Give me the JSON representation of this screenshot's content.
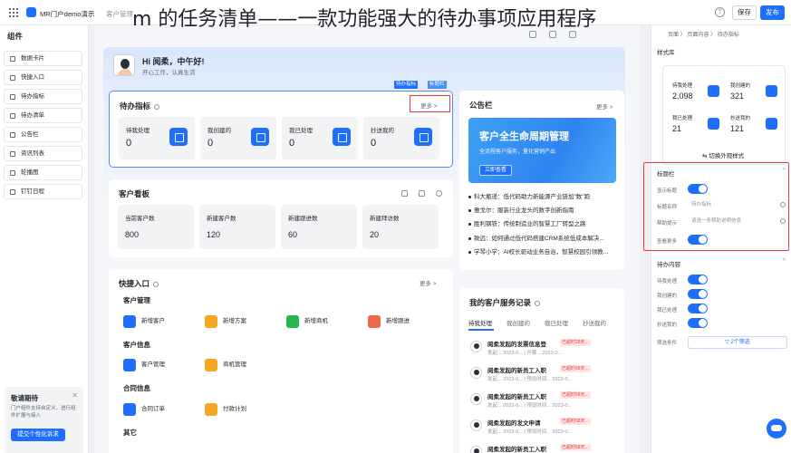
{
  "overlay_title": "m 的任务清单——一款功能强大的待办事项应用程序",
  "topbar": {
    "app_name": "MR门户demo演示",
    "page_name": "客户管理",
    "help": "?",
    "save": "保存",
    "publish": "发布"
  },
  "sidebar": {
    "title": "组件",
    "items": [
      {
        "label": "数据卡片"
      },
      {
        "label": "快捷入口"
      },
      {
        "label": "待办指标"
      },
      {
        "label": "待办清单"
      },
      {
        "label": "公告栏"
      },
      {
        "label": "资讯列表"
      },
      {
        "label": "轮播图"
      },
      {
        "label": "钉钉日程"
      }
    ],
    "promo": {
      "title": "敬请期待",
      "text": "门户组件支持自定义，进行组件扩展与接入",
      "button": "提交个性化诉求"
    }
  },
  "greeting": {
    "title": "Hi 阅柔，中午好!",
    "subtitle": "开心工作，认真生活"
  },
  "todo": {
    "title": "待办指标",
    "more": "更多 >",
    "stats": [
      {
        "label": "待我处理",
        "value": "0"
      },
      {
        "label": "我创建的",
        "value": "0"
      },
      {
        "label": "我已处理",
        "value": "0"
      },
      {
        "label": "抄送我的",
        "value": "0"
      }
    ]
  },
  "notice": {
    "title": "公告栏",
    "more": "更多 >",
    "banner": {
      "title": "客户全生命周期管理",
      "subtitle": "全流程客户服务，量化营销产出",
      "button": "立即查看"
    },
    "items": [
      "科大瓶递：低代码助力新能源产业链加\"数\"跑",
      "雅戈尔：服装行业龙头的数字创新指南",
      "胜利钢铁：传统制造业的智慧工厂转型之路",
      "致远：如何通过低代码搭建CRM系统低成本解决...",
      "学琴小学：AI校长驱动业务自治，智慧校园引领教..."
    ]
  },
  "board": {
    "title": "客户看板",
    "kpis": [
      {
        "label": "当前客户数",
        "value": "800"
      },
      {
        "label": "新建客户数",
        "value": "120"
      },
      {
        "label": "新建跟进数",
        "value": "60"
      },
      {
        "label": "新建拜访数",
        "value": "20"
      }
    ]
  },
  "quick": {
    "title": "快捷入口",
    "more": "更多 >",
    "groups": [
      {
        "title": "客户管理",
        "items": [
          {
            "label": "新增客户",
            "color": "#1e6fff"
          },
          {
            "label": "新增方案",
            "color": "#f5a623"
          },
          {
            "label": "新增商机",
            "color": "#2bb550"
          },
          {
            "label": "新增跟进",
            "color": "#f06a47"
          }
        ]
      },
      {
        "title": "客户信息",
        "items": [
          {
            "label": "客户管理",
            "color": "#1e6fff"
          },
          {
            "label": "商机管理",
            "color": "#f5a623"
          }
        ]
      },
      {
        "title": "合同信息",
        "items": [
          {
            "label": "合同订单",
            "color": "#1e6fff"
          },
          {
            "label": "付款计划",
            "color": "#f5a623"
          }
        ]
      },
      {
        "title": "其它",
        "items": []
      }
    ]
  },
  "service": {
    "title": "我的客户服务记录",
    "tabs": [
      "待我处理",
      "我创建的",
      "我已处理",
      "抄送我的"
    ],
    "records": [
      {
        "title": "阅柔发起的发票信息登",
        "tag": "已超时28天...",
        "sub": "发起... 2023-0...  | 开票... 2023-0..."
      },
      {
        "title": "阅柔发起的新员工入职",
        "tag": "已超时68天...",
        "sub": "发起... 2023-0...  | 预设时间... 2023-0..."
      },
      {
        "title": "阅柔发起的新员工入职",
        "tag": "已超时68天...",
        "sub": "发起... 2023-0...  | 预设时间... 2023-0..."
      },
      {
        "title": "阅柔发起的发文申请",
        "tag": "已超时68天...",
        "sub": "发起... 2023-0...  | 预设时间... 2023-0..."
      },
      {
        "title": "阅柔发起的新员工入职",
        "tag": "已超时68天...",
        "sub": "发起... 2023-0...  | 预设时间... 2023-0..."
      }
    ]
  },
  "right_panel": {
    "crumbs": [
      "页面",
      "页面内容",
      "待办指标"
    ],
    "style_section": "样式库",
    "mini_stats": [
      {
        "label": "待我处理",
        "value": "2,098"
      },
      {
        "label": "我创建的",
        "value": "321"
      },
      {
        "label": "我已处理",
        "value": "21"
      },
      {
        "label": "抄送我的",
        "value": "121"
      }
    ],
    "switch_style": "切换外观样式",
    "title_section": "标题栏",
    "show_title": "显示标题",
    "title_name": "标题名称",
    "title_name_value": "待办指标",
    "help_tip": "帮助提示",
    "help_tip_placeholder": "请选一条帮助说明信息",
    "show_more": "查看更多",
    "content_section": "待办内容",
    "content_items": [
      "待我处理",
      "我创建的",
      "我已处理",
      "抄送我的"
    ],
    "filter_label": "筛选条件",
    "filter_button": "2个筛选",
    "tags": [
      "待办指标",
      "标题栏"
    ]
  }
}
